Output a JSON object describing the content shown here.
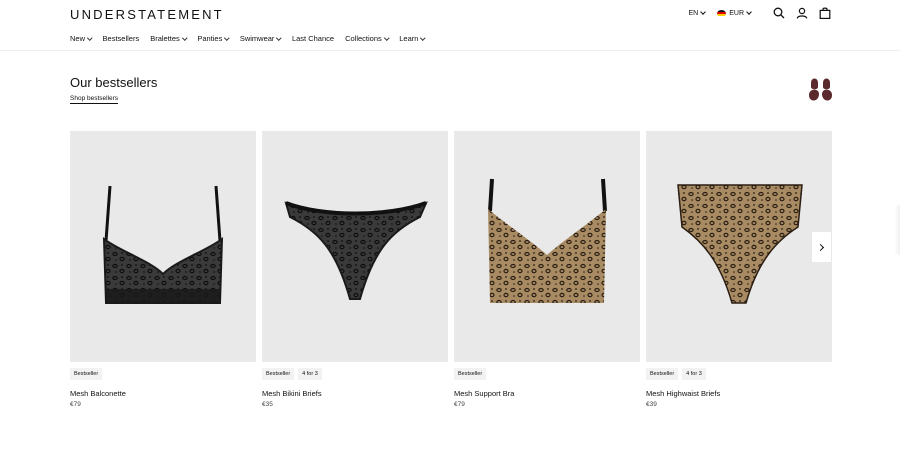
{
  "header": {
    "logo": "UNDERSTATEMENT",
    "language": "EN",
    "currency": "EUR",
    "icons": [
      "search-icon",
      "account-icon",
      "cart-icon"
    ]
  },
  "nav": {
    "items": [
      {
        "label": "New",
        "dropdown": true
      },
      {
        "label": "Bestsellers",
        "dropdown": false
      },
      {
        "label": "Bralettes",
        "dropdown": true
      },
      {
        "label": "Panties",
        "dropdown": true
      },
      {
        "label": "Swimwear",
        "dropdown": true
      },
      {
        "label": "Last Chance",
        "dropdown": false
      },
      {
        "label": "Collections",
        "dropdown": true
      },
      {
        "label": "Learn",
        "dropdown": true
      }
    ]
  },
  "section": {
    "title": "Our bestsellers",
    "link": "Shop bestsellers"
  },
  "products": [
    {
      "name": "Mesh Balconette",
      "price": "€79",
      "badges": [
        "Bestseller"
      ],
      "kind": "bra-black"
    },
    {
      "name": "Mesh Bikini Briefs",
      "price": "€35",
      "badges": [
        "Bestseller",
        "4 for 3"
      ],
      "kind": "brief-black"
    },
    {
      "name": "Mesh Support Bra",
      "price": "€79",
      "badges": [
        "Bestseller"
      ],
      "kind": "bra-leopard"
    },
    {
      "name": "Mesh Highwaist Briefs",
      "price": "€39",
      "badges": [
        "Bestseller",
        "4 for 3"
      ],
      "kind": "highwaist-leopard"
    }
  ],
  "colors": {
    "card_bg": "#e9e9e9",
    "brand_mark": "#5a2a2c",
    "leopard_base": "#a88b62",
    "black_mesh": "#1a1a1a"
  }
}
